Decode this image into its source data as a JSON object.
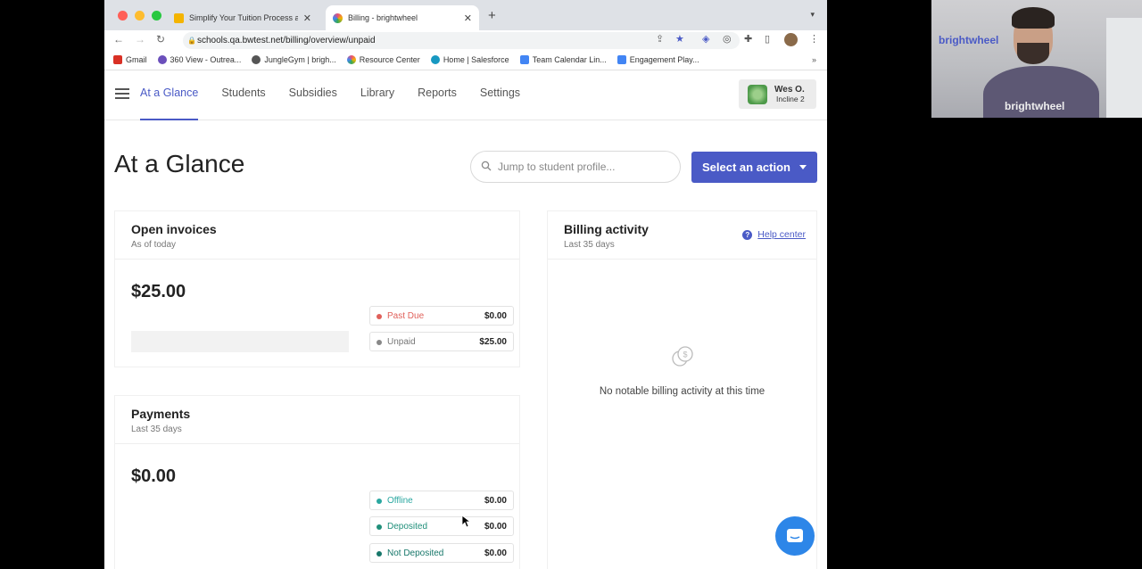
{
  "browser": {
    "tabs": [
      {
        "title": "Simplify Your Tuition Process a",
        "favicon_color": "#f4b400"
      },
      {
        "title": "Billing - brightwheel",
        "favicon_color": "#e94e77"
      }
    ],
    "url": "schools.qa.bwtest.net/billing/overview/unpaid",
    "bookmarks": [
      {
        "label": "Gmail",
        "color": "#d93025"
      },
      {
        "label": "360 View - Outrea...",
        "color": "#6b4fbb"
      },
      {
        "label": "JungleGym | brigh...",
        "color": "#555555"
      },
      {
        "label": "Resource Center",
        "color": "#e94e77"
      },
      {
        "label": "Home | Salesforce",
        "color": "#1798c1"
      },
      {
        "label": "Team Calendar Lin...",
        "color": "#4285f4"
      },
      {
        "label": "Engagement Play...",
        "color": "#4285f4"
      }
    ]
  },
  "nav": {
    "items": [
      "At a Glance",
      "Students",
      "Subsidies",
      "Library",
      "Reports",
      "Settings"
    ],
    "active": "At a Glance",
    "user_name": "Wes O.",
    "user_school": "Incline 2"
  },
  "page": {
    "title": "At a Glance",
    "search_placeholder": "Jump to student profile...",
    "action_button": "Select an action"
  },
  "open_invoices": {
    "title": "Open invoices",
    "subtitle": "As of today",
    "amount": "$25.00",
    "rows": [
      {
        "label": "Past Due",
        "value": "$0.00",
        "color": "#e0605a"
      },
      {
        "label": "Unpaid",
        "value": "$25.00",
        "color": "#888888"
      }
    ]
  },
  "payments": {
    "title": "Payments",
    "subtitle": "Last 35 days",
    "amount": "$0.00",
    "rows": [
      {
        "label": "Offline",
        "value": "$0.00",
        "color": "#2aa7a0"
      },
      {
        "label": "Deposited",
        "value": "$0.00",
        "color": "#1f8f7a"
      },
      {
        "label": "Not Deposited",
        "value": "$0.00",
        "color": "#17776a"
      }
    ]
  },
  "billing_activity": {
    "title": "Billing activity",
    "subtitle": "Last 35 days",
    "help_label": "Help center",
    "empty_text": "No notable billing activity at this time"
  },
  "webcam": {
    "logo": "brightwheel",
    "shirt_text": "brightwheel"
  },
  "colors": {
    "accent": "#4a5ac6",
    "chat": "#2d86e8"
  }
}
